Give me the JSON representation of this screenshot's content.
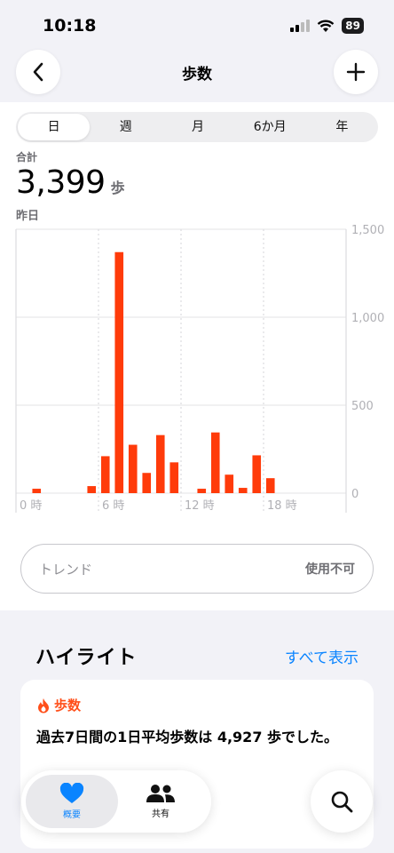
{
  "status": {
    "time": "10:18",
    "battery": "89"
  },
  "nav": {
    "title": "歩数"
  },
  "segments": [
    "日",
    "週",
    "月",
    "6か月",
    "年"
  ],
  "summary": {
    "label": "合計",
    "value": "3,399",
    "unit": "歩",
    "date": "昨日"
  },
  "chart_data": {
    "type": "bar",
    "x": [
      1,
      5,
      6,
      7,
      8,
      9,
      10,
      11,
      13,
      14,
      15,
      16,
      17,
      18
    ],
    "values": [
      25,
      40,
      210,
      1370,
      275,
      115,
      330,
      175,
      25,
      345,
      105,
      30,
      215,
      85
    ],
    "ylim": [
      0,
      1500
    ],
    "yticks": [
      "1,500",
      "1,000",
      "500",
      "0"
    ],
    "xticks": [
      "0 時",
      "6 時",
      "12 時",
      "18 時"
    ],
    "color": "#ff3b0a",
    "grid": true
  },
  "trend": {
    "label": "トレンド",
    "value": "使用不可"
  },
  "highlights": {
    "title": "ハイライト",
    "show_all": "すべて表示",
    "card": {
      "tag": "歩数",
      "text": "過去7日間の1日平均歩数は 4,927 歩でした。"
    }
  },
  "tabbar": {
    "summary": "概要",
    "share": "共有"
  }
}
